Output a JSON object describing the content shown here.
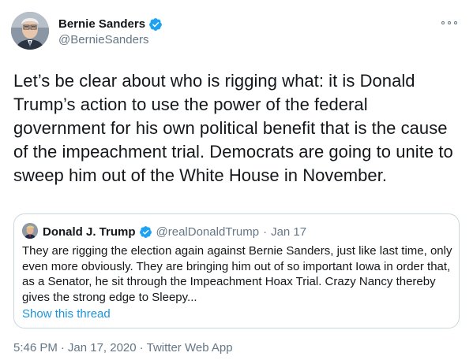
{
  "colors": {
    "text": "#14171a",
    "secondary": "#657786",
    "link": "#1b95e0",
    "verified": "#1da1f2",
    "border": "#ccd6dd"
  },
  "author": {
    "name": "Bernie Sanders",
    "handle": "@BernieSanders",
    "avatar_icon": "avatar-bernie-sanders",
    "verified_icon": "verified-badge-icon"
  },
  "menu": {
    "icon": "more-options-icon"
  },
  "tweet": {
    "text": "Let’s be clear about who is rigging what: it is Donald Trump’s action to use the power of the federal government for his own political benefit that is the cause of the impeachment trial. Democrats are going to unite to sweep him out of the White House in November."
  },
  "quote": {
    "name": "Donald J. Trump",
    "handle": "@realDonaldTrump",
    "separator": "·",
    "date": "Jan 17",
    "text": "They are rigging the election again against Bernie Sanders, just like last time, only even more obviously. They are bringing him out of so important Iowa in order that, as a Senator, he sit through the Impeachment Hoax Trial. Crazy Nancy thereby gives the strong edge to Sleepy...",
    "show_thread": "Show this thread",
    "avatar_icon": "avatar-donald-trump"
  },
  "footer": {
    "time": "5:46 PM",
    "separator": "·",
    "date": "Jan 17, 2020",
    "source": "Twitter Web App"
  }
}
